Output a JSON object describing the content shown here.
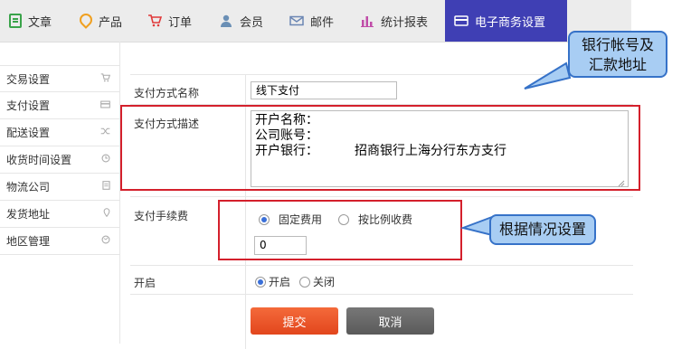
{
  "nav": {
    "tabs": [
      {
        "label": "文章",
        "icon": "document-icon"
      },
      {
        "label": "产品",
        "icon": "location-pin-icon"
      },
      {
        "label": "订单",
        "icon": "cart-icon"
      },
      {
        "label": "会员",
        "icon": "user-icon"
      },
      {
        "label": "邮件",
        "icon": "mail-icon"
      },
      {
        "label": "统计报表",
        "icon": "bar-chart-icon"
      },
      {
        "label": "电子商务设置",
        "icon": "card-icon"
      }
    ],
    "active_tab": "电子商务设置",
    "active_color": "#3f3fb4"
  },
  "sidebar": {
    "items": [
      {
        "label": "交易设置",
        "icon": "cart-icon"
      },
      {
        "label": "支付设置",
        "icon": "card-icon"
      },
      {
        "label": "配送设置",
        "icon": "shuffle-icon"
      },
      {
        "label": "收货时间设置",
        "icon": "clock-icon"
      },
      {
        "label": "物流公司",
        "icon": "list-icon"
      },
      {
        "label": "发货地址",
        "icon": "location-pin-icon"
      },
      {
        "label": "地区管理",
        "icon": "globe-icon"
      }
    ]
  },
  "form": {
    "name_label": "支付方式名称",
    "name_value": "线下支付",
    "desc_label": "支付方式描述",
    "desc_value": "开户名称：\n公司账号：\n开户银行：         招商银行上海分行东方支行",
    "fee_label": "支付手续费",
    "fee_option_fixed": "固定费用",
    "fee_option_ratio": "按比例收费",
    "fee_selected": "固定费用",
    "fee_value": "0",
    "enable_label": "开启",
    "enable_on": "开启",
    "enable_off": "关闭",
    "enable_selected": "开启",
    "submit_label": "提交",
    "cancel_label": "取消"
  },
  "annotations": {
    "callout_bank": {
      "line1": "银行帐号及",
      "line2": "汇款地址"
    },
    "callout_fee": "根据情况设置",
    "highlight_color": "#d4202c",
    "callout_fill": "#a8cdf3"
  }
}
